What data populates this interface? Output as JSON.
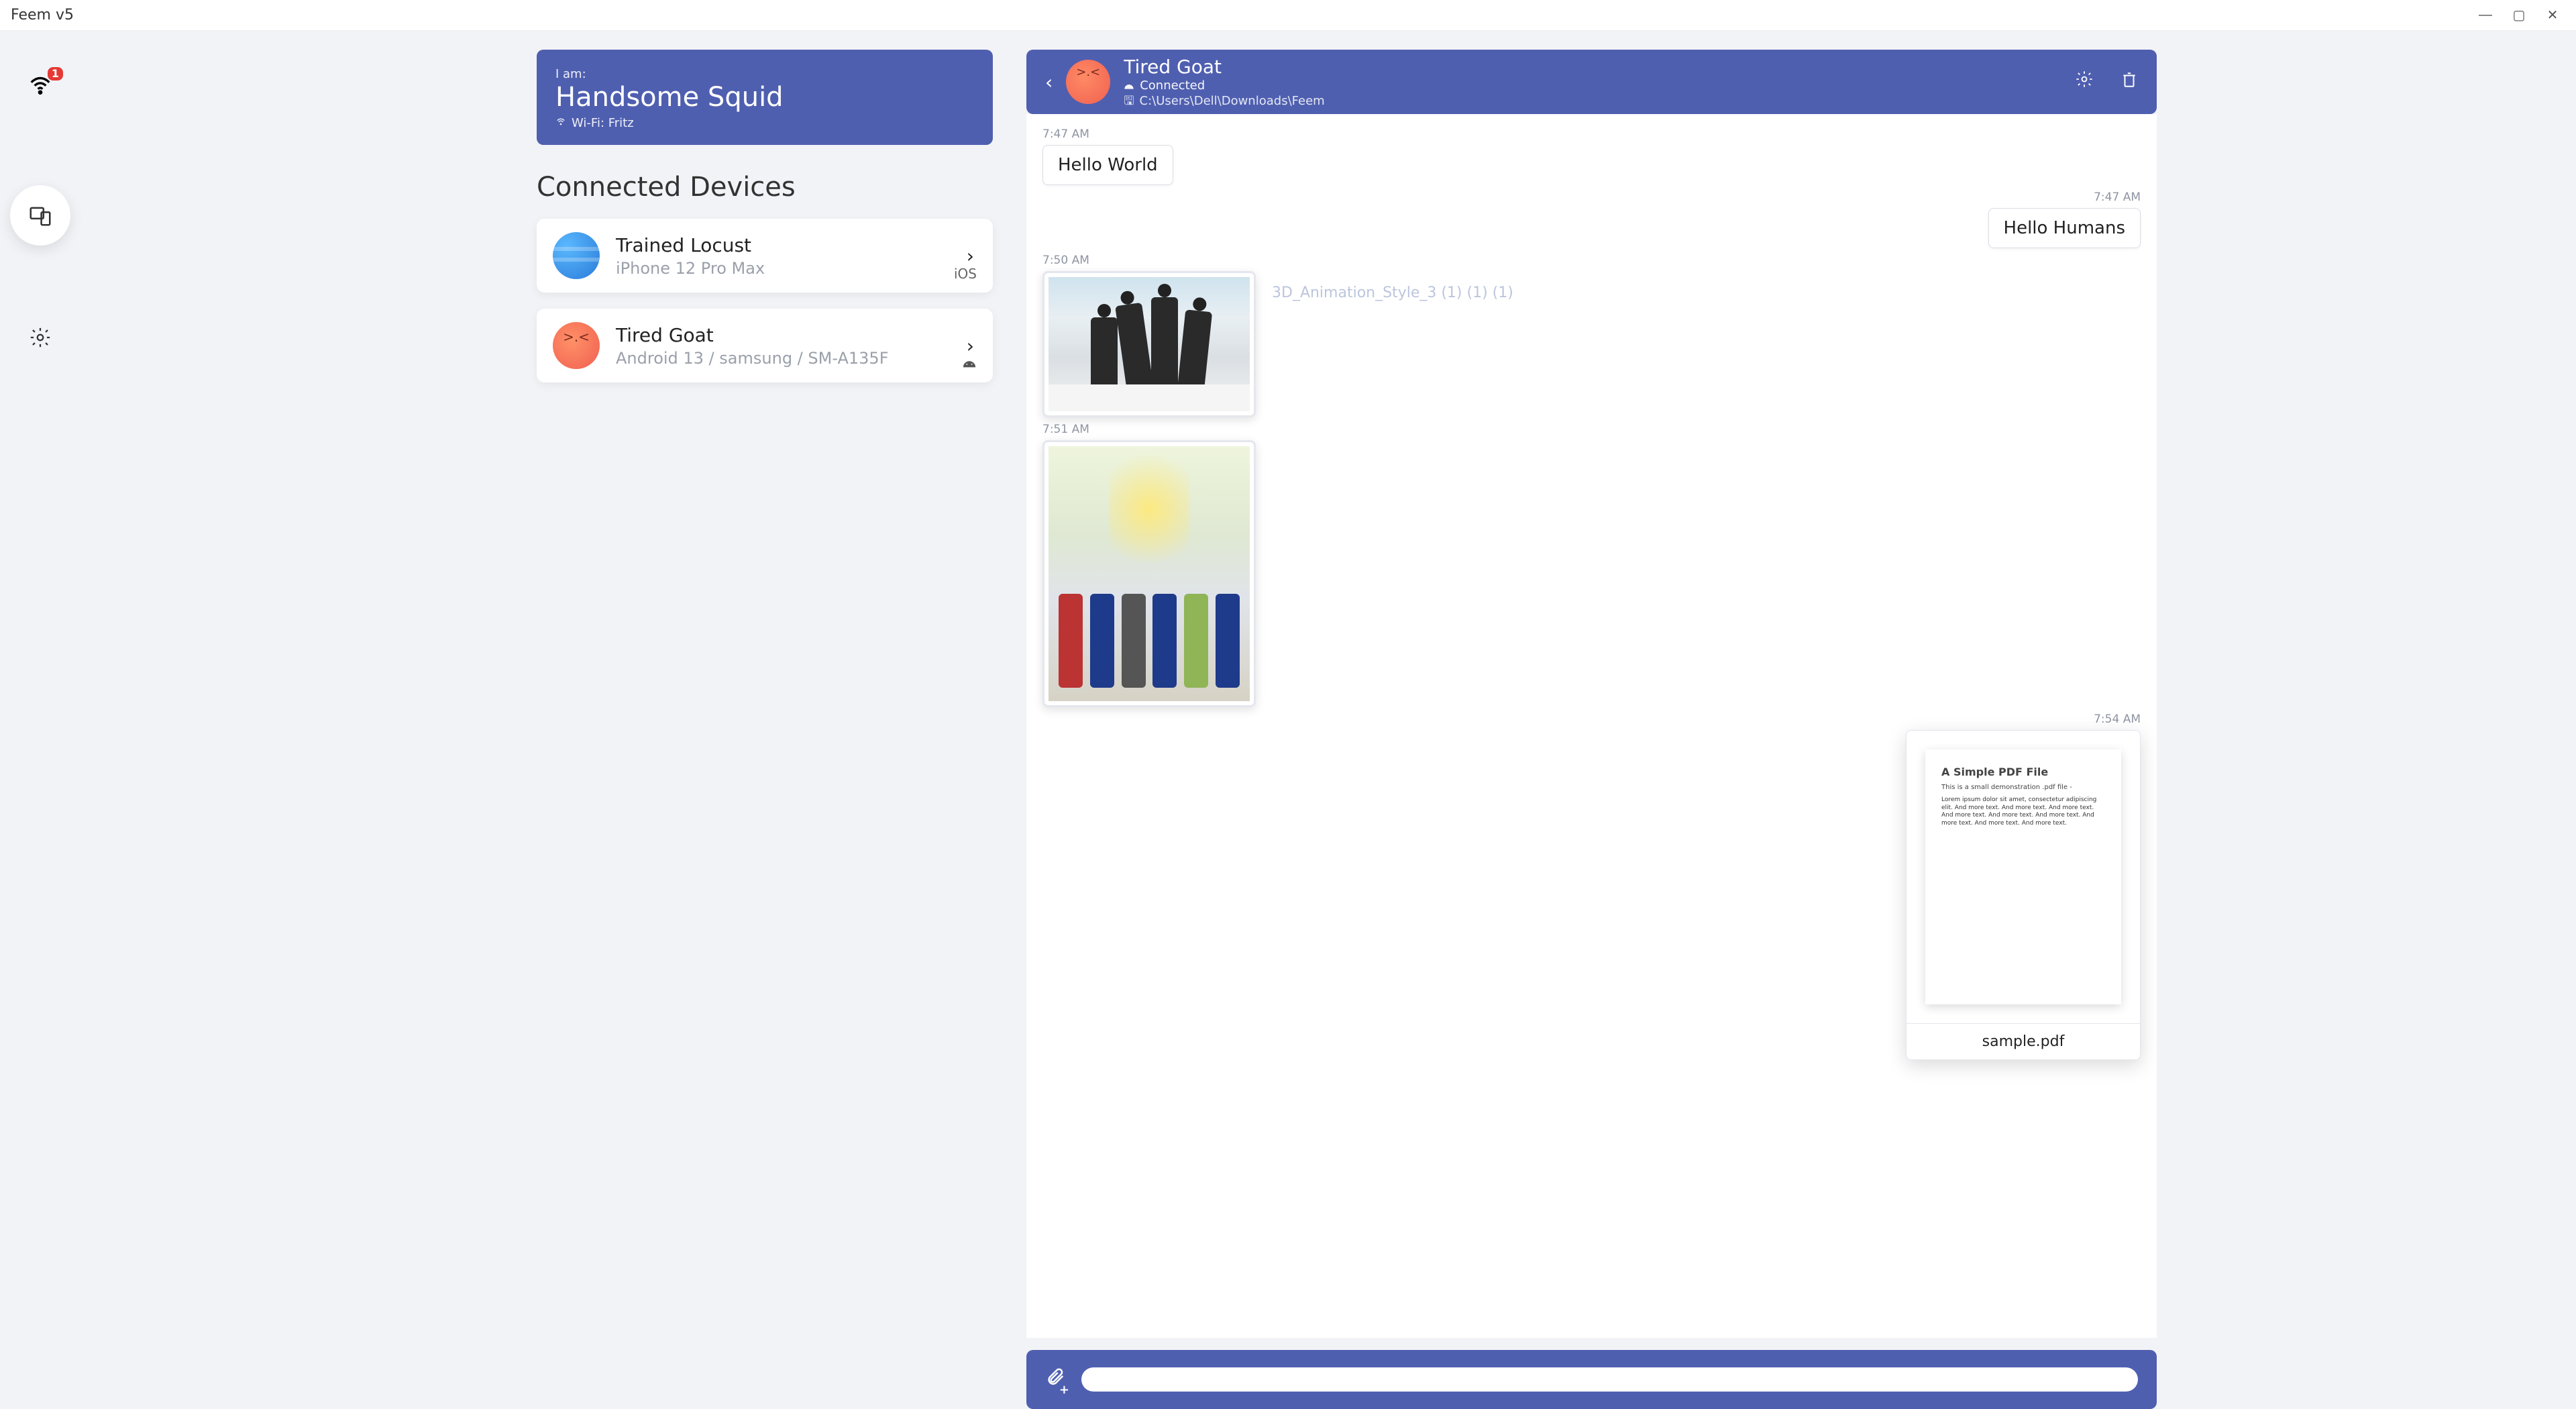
{
  "window": {
    "title": "Feem v5"
  },
  "rail": {
    "notification_count": "1"
  },
  "me": {
    "iam_label": "I am:",
    "name": "Handsome Squid",
    "network_label": "Wi-Fi: Fritz"
  },
  "devices_section_title": "Connected Devices",
  "devices": [
    {
      "name": "Trained Locust",
      "sub": "iPhone 12 Pro Max",
      "os": "iOS",
      "avatar": "blue"
    },
    {
      "name": "Tired Goat",
      "sub": "Android 13 / samsung / SM-A135F",
      "os": "android",
      "avatar": "orange"
    }
  ],
  "chat": {
    "title": "Tired Goat",
    "status": "Connected",
    "path": "C:\\Users\\Dell\\Downloads\\Feem",
    "messages": {
      "m1_time": "7:47 AM",
      "m1_text": "Hello World",
      "m2_time": "7:47 AM",
      "m2_text": "Hello Humans",
      "m3_time": "7:50 AM",
      "m3_caption": "3D_Animation_Style_3 (1) (1) (1)",
      "m4_time": "7:51 AM",
      "m5_time": "7:54 AM",
      "pdf_title": "A Simple PDF File",
      "pdf_sub": "This is a small demonstration .pdf file -",
      "pdf_para": "Lorem ipsum dolor sit amet, consectetur adipiscing elit. And more text. And more text. And more text. And more text. And more text. And more text. And more text. And more text. And more text.",
      "pdf_name": "sample.pdf"
    },
    "compose_placeholder": ""
  }
}
